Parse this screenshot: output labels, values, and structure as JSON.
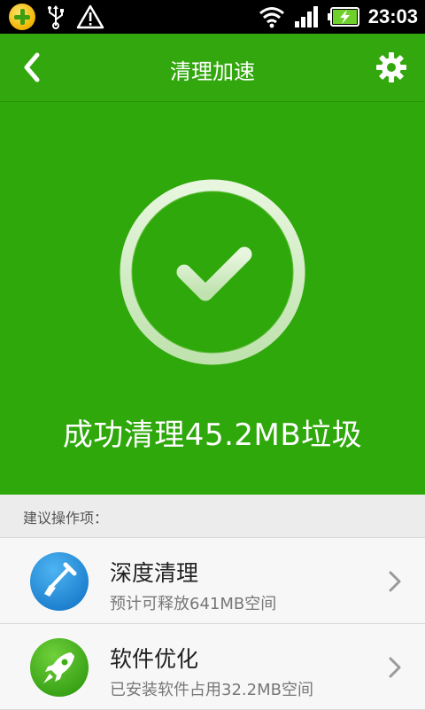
{
  "status_bar": {
    "time": "23:03",
    "icons": [
      "app-badge-icon",
      "usb-icon",
      "warning-icon",
      "wifi-icon",
      "signal-icon",
      "battery-charging-icon"
    ]
  },
  "header": {
    "title": "清理加速",
    "back_icon": "chevron-left-icon",
    "settings_icon": "gear-icon"
  },
  "hero": {
    "result": "成功清理45.2MB垃圾",
    "icon": "check-circle-icon"
  },
  "suggestions": {
    "label": "建议操作项：",
    "items": [
      {
        "title": "深度清理",
        "subtitle": "预计可释放641MB空间",
        "icon": "shovel-icon",
        "color": "#1e8fd8"
      },
      {
        "title": "软件优化",
        "subtitle": "已安装软件占用32.2MB空间",
        "icon": "rocket-icon",
        "color": "#3fae17"
      }
    ]
  },
  "colors": {
    "brand_green": "#2ea80a",
    "header_green": "#33a70e",
    "blue": "#1e8fd8"
  }
}
